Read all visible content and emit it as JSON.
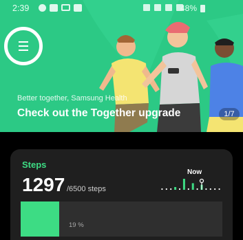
{
  "status_bar": {
    "time": "2:39",
    "battery": "48%",
    "left_icons": [
      "messenger-icon",
      "video-icon",
      "gallery-icon",
      "notification-icon"
    ],
    "right_icons": [
      "vibrate-icon",
      "bluetooth-icon",
      "wifi-icon",
      "signal-icon",
      "battery-icon"
    ]
  },
  "banner": {
    "subtitle": "Better together, Samsung Health",
    "title": "Check out the Together upgrade",
    "page_indicator": "1/7",
    "background_color": "#2cc985",
    "menu_icon": "hamburger-menu-icon"
  },
  "steps": {
    "label": "Steps",
    "count": "1297",
    "goal": "/6500 steps",
    "now_label": "Now",
    "progress_text": "19 %",
    "progress_fraction": 0.19,
    "accent_color": "#3ddc84",
    "trend_values": [
      0,
      0,
      0,
      0.25,
      0,
      1,
      0,
      0.6,
      0,
      0.45,
      0,
      0,
      0,
      0
    ]
  }
}
